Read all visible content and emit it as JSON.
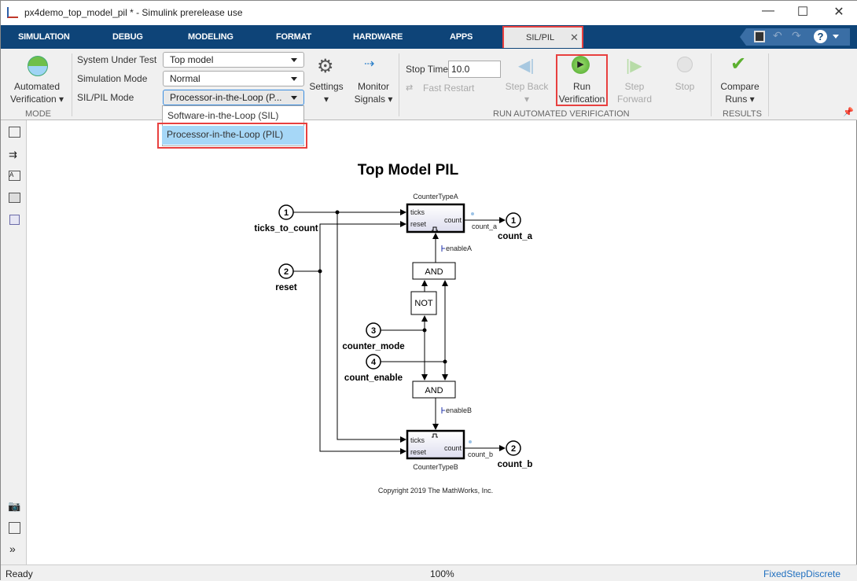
{
  "window": {
    "title": "px4demo_top_model_pil * - Simulink prerelease use"
  },
  "tabs": [
    "SIMULATION",
    "DEBUG",
    "MODELING",
    "FORMAT",
    "HARDWARE",
    "APPS",
    "SIL/PIL"
  ],
  "ribbon": {
    "mode": {
      "button": "Automated",
      "button2": "Verification",
      "section": "MODE"
    },
    "system_under_test": {
      "label": "System Under Test",
      "value": "Top model"
    },
    "simulation_mode": {
      "label": "Simulation Mode",
      "value": "Normal"
    },
    "silpil_mode": {
      "label": "SIL/PIL Mode",
      "value": "Processor-in-the-Loop (P..."
    },
    "settings": "Settings",
    "monitor": {
      "l1": "Monitor",
      "l2": "Signals"
    },
    "stop_time": {
      "label": "Stop Time",
      "value": "10.0"
    },
    "fast_restart": "Fast Restart",
    "step_back": "Step Back",
    "run": {
      "l1": "Run",
      "l2": "Verification"
    },
    "step_forward": {
      "l1": "Step",
      "l2": "Forward"
    },
    "stop": "Stop",
    "run_section": "RUN AUTOMATED VERIFICATION",
    "compare": {
      "l1": "Compare",
      "l2": "Runs"
    },
    "results_section": "RESULTS"
  },
  "dropdown_options": [
    "Software-in-the-Loop (SIL)",
    "Processor-in-the-Loop (PIL)"
  ],
  "diagram": {
    "title": "Top Model PIL",
    "inports": [
      {
        "n": "1",
        "label": "ticks_to_count"
      },
      {
        "n": "2",
        "label": "reset"
      },
      {
        "n": "3",
        "label": "counter_mode"
      },
      {
        "n": "4",
        "label": "count_enable"
      }
    ],
    "outports": [
      {
        "n": "1",
        "label": "count_a"
      },
      {
        "n": "2",
        "label": "count_b"
      }
    ],
    "blockA": {
      "name": "CounterTypeA",
      "in1": "ticks",
      "in2": "reset",
      "out": "count",
      "signal": "count_a",
      "enable": "enableA"
    },
    "blockB": {
      "name": "CounterTypeB",
      "in1": "ticks",
      "in2": "reset",
      "out": "count",
      "signal": "count_b",
      "enable": "enableB"
    },
    "and": "AND",
    "not": "NOT",
    "copyright": "Copyright 2019 The MathWorks, Inc."
  },
  "status": {
    "left": "Ready",
    "zoom": "100%",
    "solver": "FixedStepDiscrete"
  }
}
